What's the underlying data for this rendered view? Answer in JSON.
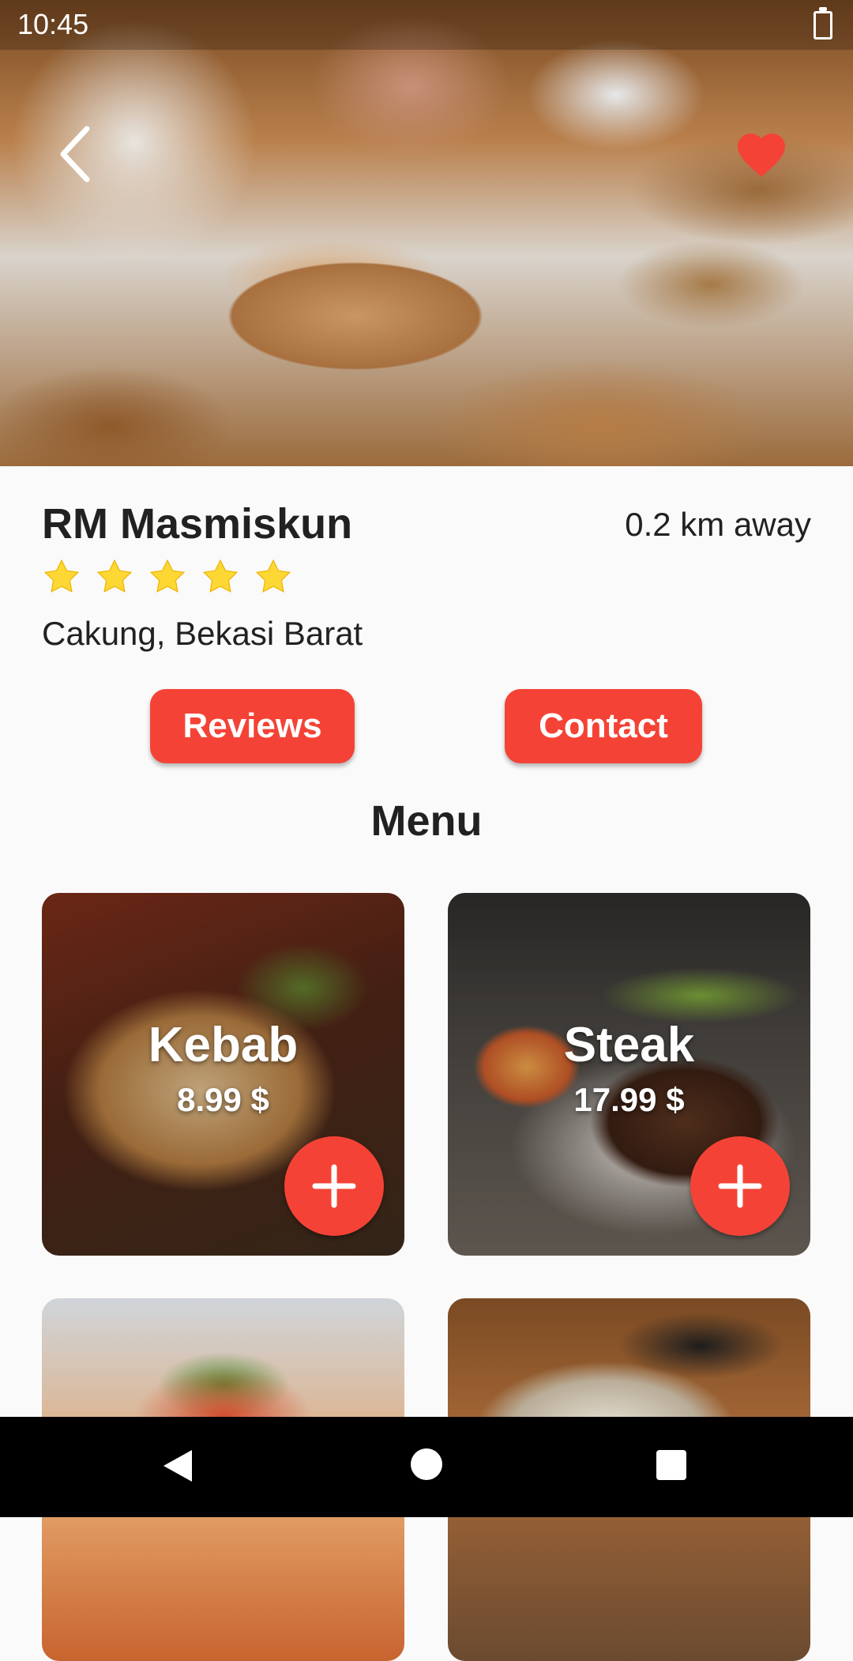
{
  "status_bar": {
    "time": "10:45",
    "battery_icon": "battery-icon"
  },
  "header": {
    "back_icon": "chevron-left-icon",
    "favorite_icon": "heart-icon",
    "favorite_color": "#f44336"
  },
  "restaurant": {
    "name": "RM Masmiskun",
    "distance": "0.2 km away",
    "rating": 5,
    "rating_max": 5,
    "address": "Cakung, Bekasi Barat"
  },
  "actions": {
    "reviews_label": "Reviews",
    "contact_label": "Contact"
  },
  "menu": {
    "title": "Menu",
    "items": [
      {
        "name": "Kebab",
        "price": "8.99 $"
      },
      {
        "name": "Steak",
        "price": "17.99 $"
      }
    ]
  },
  "colors": {
    "accent": "#f44336",
    "star": "#fdd835",
    "background": "#fafafa"
  },
  "nav_bar": {
    "back_icon": "triangle-back-icon",
    "home_icon": "circle-home-icon",
    "recents_icon": "square-recents-icon"
  }
}
